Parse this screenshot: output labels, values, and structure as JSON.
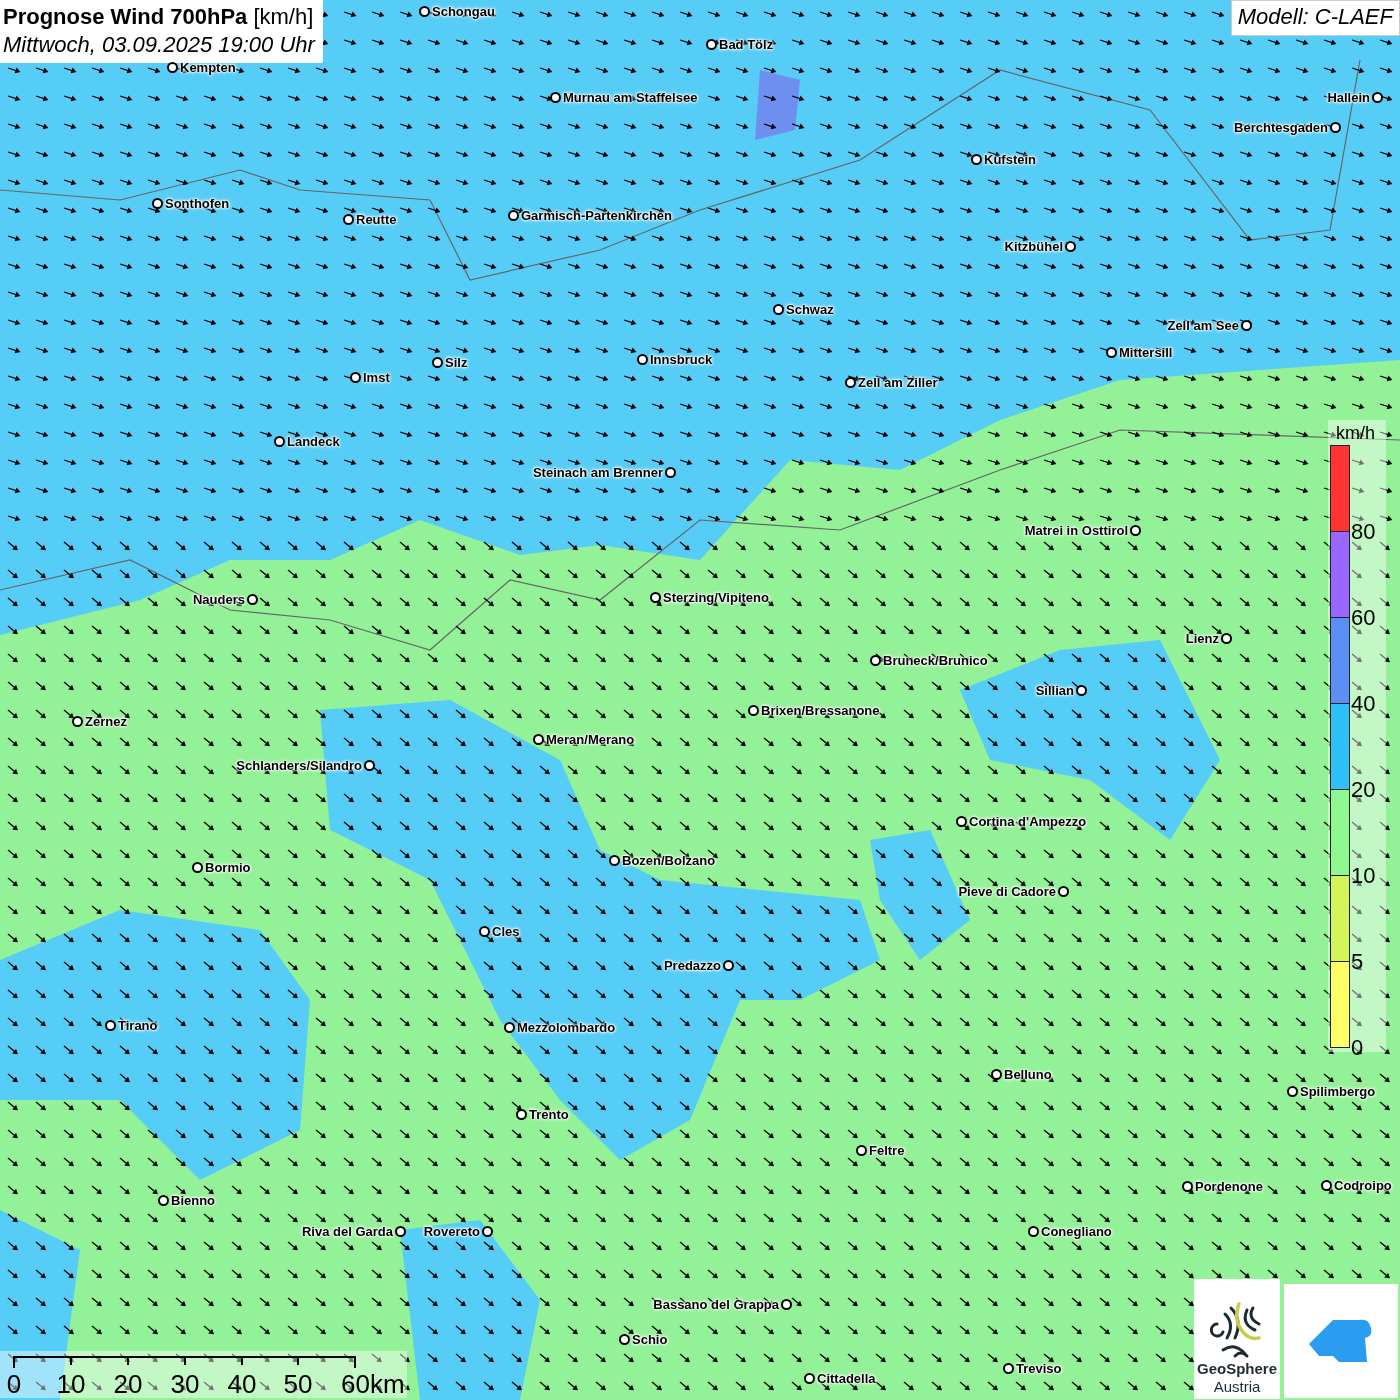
{
  "header": {
    "title": "**Prognose Wind 700hPa** [km/h]",
    "subtitle": "Mittwoch, 03.09.2025 19:00 Uhr"
  },
  "model": "Modell: C-LAEF",
  "cities": [
    "Schongau",
    "Bad Tölz",
    "Kempten",
    "Murnau am Staffelsee",
    "Hallein",
    "Berchtesgaden",
    "Kufstein",
    "Sonthofen",
    "Reutte",
    "Garmisch-Partenkirchen",
    "Kitzbühel",
    "Schwaz",
    "Zell am See",
    "Mittersill",
    "Innsbruck",
    "Silz",
    "Imst",
    "Zell am Ziller",
    "Landeck",
    "Steinach am Brenner",
    "Matrei in Osttirol",
    "Nauders",
    "Sterzing/Vipiteno",
    "Lienz",
    "Bruneck/Brunico",
    "Sillian",
    "Zernez",
    "Brixen/Bressanone",
    "Meran/Merano",
    "Schlanders/Silandro",
    "Cortina d'Ampezzo",
    "Bozen/Bolzano",
    "Bormio",
    "Pieve di Cadore",
    "Cles",
    "Predazzo",
    "Tirano",
    "Mezzolombardo",
    "Belluno",
    "Spilimbergo",
    "Trento",
    "Feltre",
    "Pordenone",
    "Codroipo",
    "Bienno",
    "Riva del Garda",
    "Rovereto",
    "Conegliano",
    "Bassano del Grappa",
    "Schio",
    "Treviso",
    "Cittadella"
  ],
  "legend": {
    "unit": "km/h",
    "steps": [
      {
        "label": "80",
        "color": "#ff3333"
      },
      {
        "label": "60",
        "color": "#9966ff"
      },
      {
        "label": "40",
        "color": "#5b8ff5"
      },
      {
        "label": "20",
        "color": "#30c0f8"
      },
      {
        "label": "10",
        "color": "#90f890"
      },
      {
        "label": "5",
        "color": "#d4f55a"
      },
      {
        "label": "0",
        "color": "#ffff66"
      }
    ]
  },
  "scale_bar": [
    "0",
    "10",
    "20",
    "30",
    "40",
    "50",
    "60km"
  ],
  "logo": {
    "name": "GeoSphere",
    "subname": "Austria"
  }
}
